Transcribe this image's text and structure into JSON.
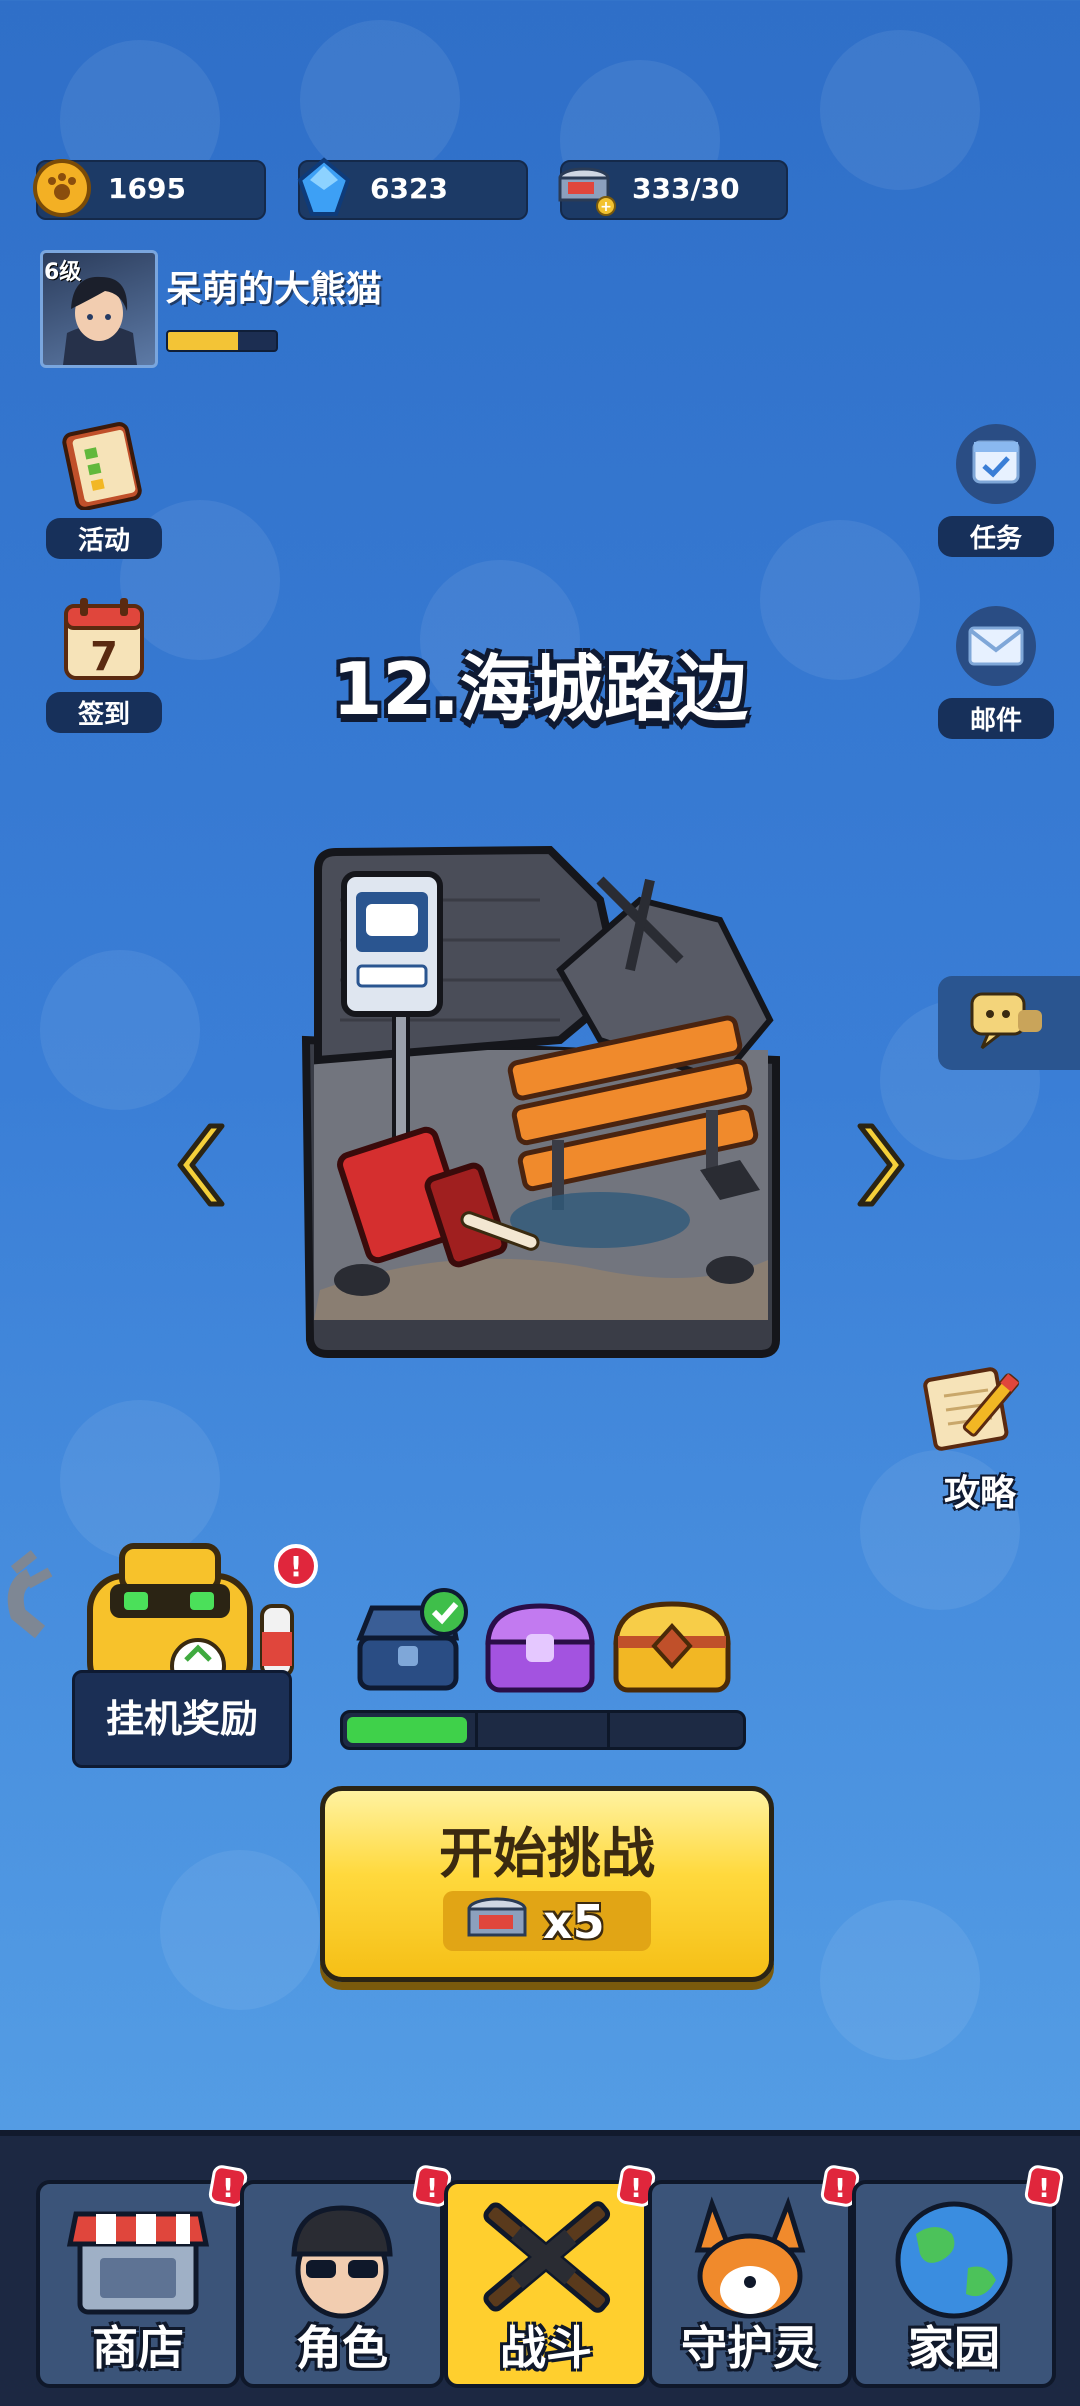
{
  "resources": [
    {
      "name": "paw-coins",
      "value": "1695"
    },
    {
      "name": "gems",
      "value": "6323"
    },
    {
      "name": "stamina",
      "value": "333/30"
    }
  ],
  "player": {
    "level": "6级",
    "name": "呆萌的大熊猫",
    "xp_fraction": 0.65
  },
  "side_left": [
    {
      "label": "活动"
    },
    {
      "label": "签到",
      "calendar_day": "7"
    }
  ],
  "side_right": [
    {
      "label": "任务"
    },
    {
      "label": "邮件"
    },
    {
      "label": "攻略"
    }
  ],
  "stage": {
    "title": "12.海城路边"
  },
  "idle": {
    "label": "挂机奖励"
  },
  "chest_progress": 0.32,
  "start": {
    "label": "开始挑战",
    "cost": "x5"
  },
  "nav": [
    {
      "label": "商店"
    },
    {
      "label": "角色"
    },
    {
      "label": "战斗",
      "active": true
    },
    {
      "label": "守护灵"
    },
    {
      "label": "家园"
    }
  ],
  "colors": {
    "accent": "#ffcf2e",
    "panel": "#1c3a66",
    "progress": "#3fd14a"
  }
}
